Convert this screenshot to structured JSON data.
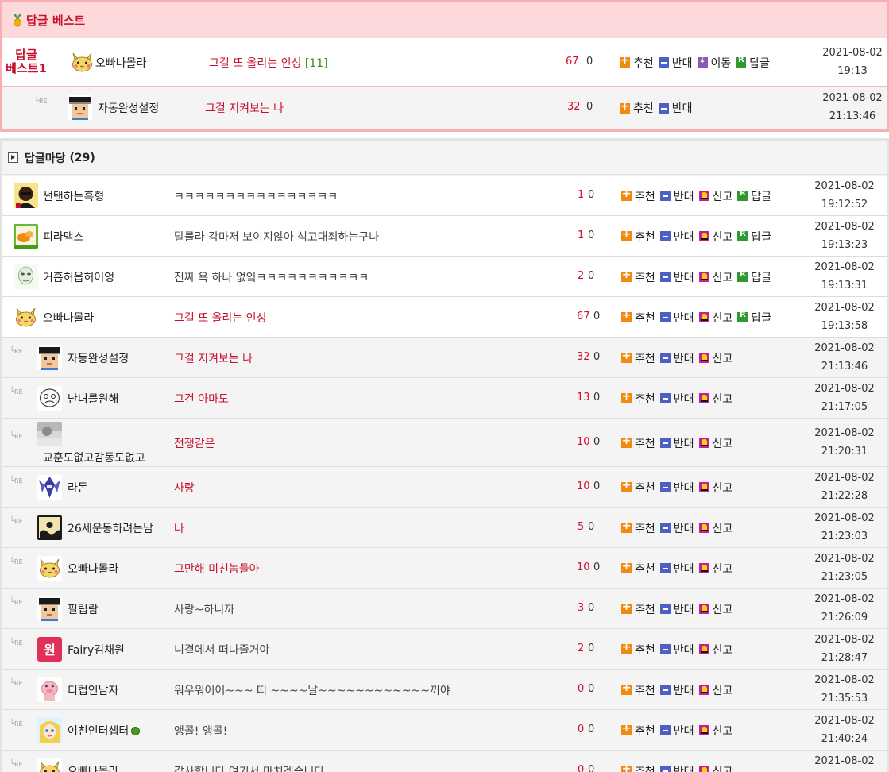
{
  "best": {
    "title": "답글 베스트",
    "badge_line1": "답글",
    "badge_line2": "베스트1",
    "rows": [
      {
        "nick": "오빠나몰라",
        "subject": "그걸 또 올리는 인성",
        "count": "[11]",
        "rec": "67",
        "opp": "0",
        "actions": [
          "추천",
          "반대",
          "이동",
          "답글"
        ],
        "date": "2021-08-02",
        "time": "19:13",
        "avatar": "pikachu",
        "reply": false
      },
      {
        "nick": "자동완성설정",
        "subject": "그걸 지켜보는 나",
        "count": "",
        "rec": "32",
        "opp": "0",
        "actions": [
          "추천",
          "반대"
        ],
        "date": "2021-08-02",
        "time": "21:13:46",
        "avatar": "pixelman",
        "reply": true
      }
    ]
  },
  "board": {
    "title": "답글마당",
    "count": "(29)",
    "re_label": "RE",
    "rows": [
      {
        "nick": "썬탠하는흑형",
        "subject": "ㅋㅋㅋㅋㅋㅋㅋㅋㅋㅋㅋㅋㅋㅋㅋㅋ",
        "red": false,
        "rec": "1",
        "opp": "0",
        "actions": [
          "추천",
          "반대",
          "신고",
          "답글"
        ],
        "date": "2021-08-02",
        "time": "19:12:52",
        "avatar": "dark",
        "reply": false
      },
      {
        "nick": "피라맥스",
        "subject": "탈룰라 각마저 보이지않아 석고대죄하는구나",
        "red": false,
        "rec": "1",
        "opp": "0",
        "actions": [
          "추천",
          "반대",
          "신고",
          "답글"
        ],
        "date": "2021-08-02",
        "time": "19:13:23",
        "avatar": "food",
        "reply": false
      },
      {
        "nick": "커흡허읍허어엉",
        "subject": "진짜 욕 하나 없잌ㅋㅋㅋㅋㅋㅋㅋㅋㅋㅋㅋ",
        "red": false,
        "rec": "2",
        "opp": "0",
        "actions": [
          "추천",
          "반대",
          "신고",
          "답글"
        ],
        "date": "2021-08-02",
        "time": "19:13:31",
        "avatar": "alien",
        "reply": false
      },
      {
        "nick": "오빠나몰라",
        "subject": "그걸 또 올리는 인성",
        "red": true,
        "rec": "67",
        "opp": "0",
        "actions": [
          "추천",
          "반대",
          "신고",
          "답글"
        ],
        "date": "2021-08-02",
        "time": "19:13:58",
        "avatar": "pikachu",
        "reply": false
      },
      {
        "nick": "자동완성설정",
        "subject": "그걸 지켜보는 나",
        "red": true,
        "rec": "32",
        "opp": "0",
        "actions": [
          "추천",
          "반대",
          "신고"
        ],
        "date": "2021-08-02",
        "time": "21:13:46",
        "avatar": "pixelman",
        "reply": true
      },
      {
        "nick": "난녀를원해",
        "subject": "그건 아마도",
        "red": true,
        "rec": "13",
        "opp": "0",
        "actions": [
          "추천",
          "반대",
          "신고"
        ],
        "date": "2021-08-02",
        "time": "21:17:05",
        "avatar": "sketch",
        "reply": true
      },
      {
        "nick": "교훈도없고감동도없고",
        "subject": "전쟁같은",
        "red": true,
        "rec": "10",
        "opp": "0",
        "actions": [
          "추천",
          "반대",
          "신고"
        ],
        "date": "2021-08-02",
        "time": "21:20:31",
        "avatar": "photo",
        "reply": true,
        "tall": true
      },
      {
        "nick": "라돈",
        "subject": "사랑",
        "red": true,
        "rec": "10",
        "opp": "0",
        "actions": [
          "추천",
          "반대",
          "신고"
        ],
        "date": "2021-08-02",
        "time": "21:22:28",
        "avatar": "robot",
        "reply": true
      },
      {
        "nick": "26세운동하려는남",
        "subject": "나",
        "red": true,
        "rec": "5",
        "opp": "0",
        "actions": [
          "추천",
          "반대",
          "신고"
        ],
        "date": "2021-08-02",
        "time": "21:23:03",
        "avatar": "wave",
        "reply": true
      },
      {
        "nick": "오빠나몰라",
        "subject": "그만해 미친놈들아",
        "red": true,
        "rec": "10",
        "opp": "0",
        "actions": [
          "추천",
          "반대",
          "신고"
        ],
        "date": "2021-08-02",
        "time": "21:23:05",
        "avatar": "pikachu",
        "reply": true
      },
      {
        "nick": "필립람",
        "subject": "사랑~하니까",
        "red": false,
        "rec": "3",
        "opp": "0",
        "actions": [
          "추천",
          "반대",
          "신고"
        ],
        "date": "2021-08-02",
        "time": "21:26:09",
        "avatar": "pixelman",
        "reply": true
      },
      {
        "nick": "Fairy김채원",
        "subject": "니곁에서 떠나줄거야",
        "red": false,
        "rec": "2",
        "opp": "0",
        "actions": [
          "추천",
          "반대",
          "신고"
        ],
        "date": "2021-08-02",
        "time": "21:28:47",
        "avatar": "won",
        "reply": true
      },
      {
        "nick": "디컵인남자",
        "subject": "워우워어어~~~ 떠 ~~~~날~~~~~~~~~~~~꺼야",
        "red": false,
        "rec": "0",
        "opp": "0",
        "actions": [
          "추천",
          "반대",
          "신고"
        ],
        "date": "2021-08-02",
        "time": "21:35:53",
        "avatar": "pig",
        "reply": true
      },
      {
        "nick": "여친인터셉터",
        "subject": "앵콜! 앵콜!",
        "red": false,
        "rec": "0",
        "opp": "0",
        "actions": [
          "추천",
          "반대",
          "신고"
        ],
        "date": "2021-08-02",
        "time": "21:40:24",
        "avatar": "anime",
        "reply": true,
        "online": true
      },
      {
        "nick": "오빠나몰라",
        "subject": "감사합니다 여기서 마치겠습니다.",
        "red": false,
        "rec": "0",
        "opp": "0",
        "actions": [
          "추천",
          "반대",
          "신고"
        ],
        "date": "2021-08-02",
        "time": "",
        "avatar": "pikachu",
        "reply": true
      }
    ]
  },
  "colors": {
    "accent": "#c8102e",
    "best_border": "#f9aeb3",
    "best_header": "#fdd9dc",
    "count_green": "#3a8a1a"
  },
  "icons": {
    "recommend": "plus-square-icon",
    "oppose": "minus-square-icon",
    "move": "arrow-down-icon",
    "reply": "reply-r-icon",
    "report": "siren-icon"
  }
}
